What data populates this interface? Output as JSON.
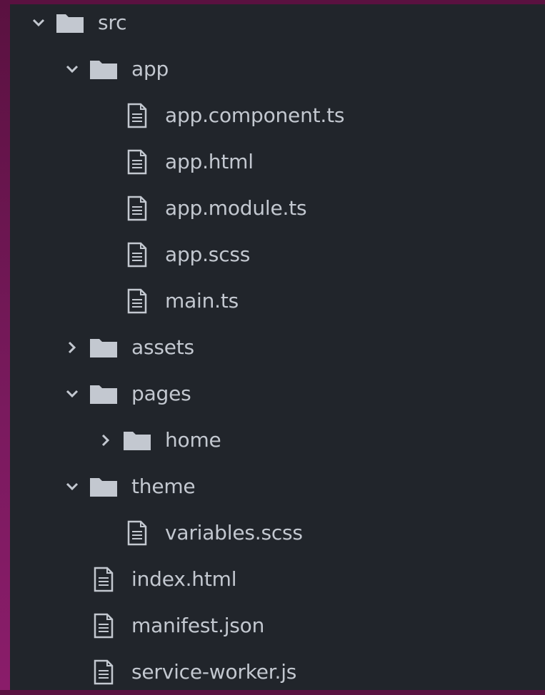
{
  "tree": {
    "colors": {
      "panel_bg": "#21252b",
      "text": "#c3c8d0",
      "icon": "#c3c8d0"
    },
    "rows": [
      {
        "label": "src",
        "type": "folder",
        "expanded": "open",
        "depth": 0
      },
      {
        "label": "app",
        "type": "folder",
        "expanded": "open",
        "depth": 1
      },
      {
        "label": "app.component.ts",
        "type": "file",
        "depth": 2
      },
      {
        "label": "app.html",
        "type": "file",
        "depth": 2
      },
      {
        "label": "app.module.ts",
        "type": "file",
        "depth": 2
      },
      {
        "label": "app.scss",
        "type": "file",
        "depth": 2
      },
      {
        "label": "main.ts",
        "type": "file",
        "depth": 2
      },
      {
        "label": "assets",
        "type": "folder",
        "expanded": "closed",
        "depth": 1
      },
      {
        "label": "pages",
        "type": "folder",
        "expanded": "open",
        "depth": 1
      },
      {
        "label": "home",
        "type": "folder",
        "expanded": "closed",
        "depth": 2
      },
      {
        "label": "theme",
        "type": "folder",
        "expanded": "open",
        "depth": 1
      },
      {
        "label": "variables.scss",
        "type": "file",
        "depth": 2
      },
      {
        "label": "index.html",
        "type": "file",
        "depth": 1
      },
      {
        "label": "manifest.json",
        "type": "file",
        "depth": 1
      },
      {
        "label": "service-worker.js",
        "type": "file",
        "depth": 1
      }
    ],
    "icons": {
      "folder": "folder-icon",
      "file": "file-icon",
      "expanded": "chevron-down-icon",
      "collapsed": "chevron-right-icon"
    }
  }
}
